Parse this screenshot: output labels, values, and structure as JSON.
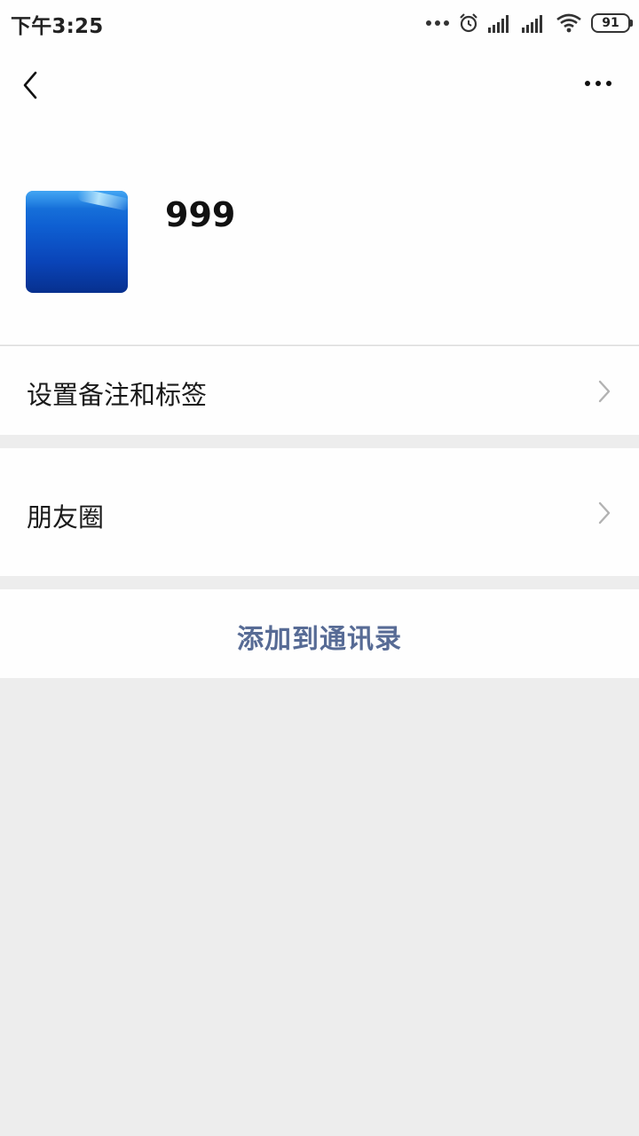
{
  "status_bar": {
    "time": "下午3:25",
    "battery": "91",
    "icons": [
      "more-dots-icon",
      "alarm-icon",
      "signal-icon",
      "signal-icon",
      "wifi-icon",
      "battery-icon"
    ]
  },
  "nav": {
    "back_icon": "chevron-left-icon",
    "more_icon": "more-dots-icon"
  },
  "profile": {
    "name": "999"
  },
  "rows": {
    "remark_label": "设置备注和标签",
    "moments_label": "朋友圈"
  },
  "action": {
    "add_label": "添加到通讯录"
  },
  "colors": {
    "link": "#576b95",
    "background": "#ededed",
    "surface": "#fefefe"
  }
}
